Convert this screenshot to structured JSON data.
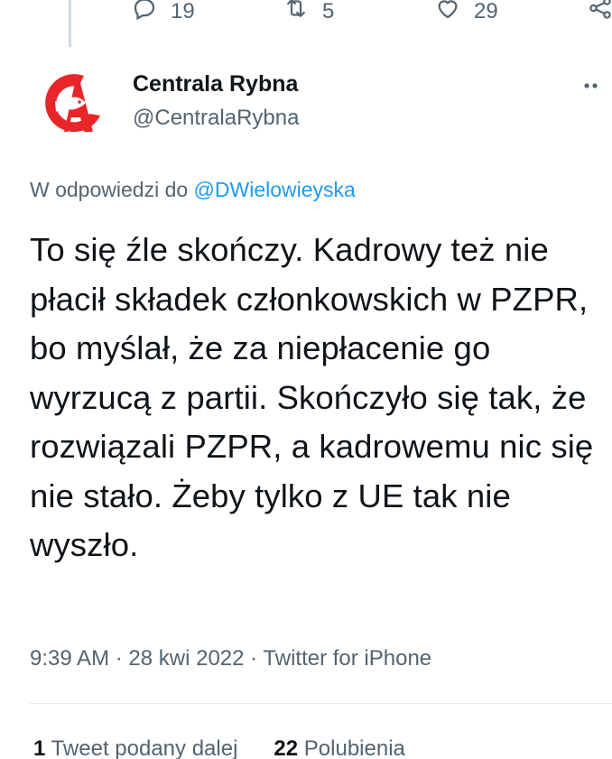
{
  "prev_tweet_actions": {
    "reply_count": "19",
    "retweet_count": "5",
    "like_count": "29"
  },
  "author": {
    "display_name": "Centrala Rybna",
    "handle": "@CentralaRybna"
  },
  "reply_to": {
    "prefix": "W odpowiedzi do",
    "mention": "@DWielowieyska"
  },
  "tweet": {
    "text": "To się źle skończy. Kadrowy też nie płacił składek członkowskich w PZPR, bo myślał, że za niepłacenie go wyrzucą z partii. Skończyło się tak, że rozwiązali PZPR, a kadrowemu nic się nie stało. Żeby tylko z UE tak nie wyszło."
  },
  "meta": {
    "time": "9:39 AM",
    "date": "28 kwi 2022",
    "source": "Twitter for iPhone",
    "separator": "·"
  },
  "stats": {
    "retweets_count": "1",
    "retweets_label": "Tweet podany dalej",
    "likes_count": "22",
    "likes_label": "Polubienia"
  },
  "colors": {
    "accent": "#1d9bf0",
    "secondary_text": "#536471",
    "logo_red": "#e8262a"
  },
  "icons": [
    "reply-icon",
    "retweet-icon",
    "like-icon",
    "share-icon",
    "more-icon"
  ]
}
